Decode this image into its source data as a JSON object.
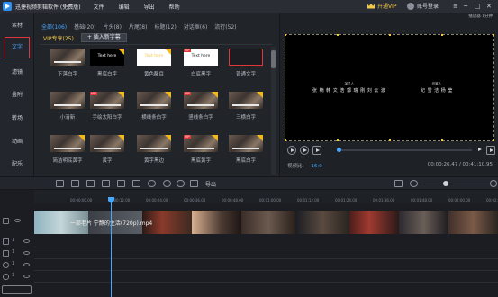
{
  "app": {
    "title": "迅捷视频剪辑软件 (免费版)",
    "menu": [
      "文件",
      "编辑",
      "导出",
      "帮助"
    ],
    "vip_label": "开通VIP",
    "login_label": "账号登录",
    "window_controls": [
      "≡",
      "─",
      "□",
      "✕"
    ],
    "accent": "#48a7ff",
    "highlight": "#e0353b"
  },
  "sidebar": {
    "items": [
      {
        "label": "素材"
      },
      {
        "label": "文字"
      },
      {
        "label": "滤镜"
      },
      {
        "label": "叠附"
      },
      {
        "label": "转场"
      },
      {
        "label": "动画"
      },
      {
        "label": "配乐"
      }
    ],
    "active_index": 1
  },
  "library": {
    "tabs": [
      "全部(106)",
      "基础(20)",
      "片头(8)",
      "片尾(8)",
      "标题(12)",
      "对话框(6)",
      "流行(52)"
    ],
    "active_tab": 0,
    "vip_tag": "VIP专享(25)",
    "add_button": "+ 插入新字幕",
    "items": [
      {
        "label": "下落白字",
        "style": "photo",
        "corner": false
      },
      {
        "label": "黑底白字",
        "style": "black",
        "text": "Text here",
        "corner": true,
        "vip": false
      },
      {
        "label": "黄色醒目",
        "style": "white",
        "text": "Text here",
        "corner": true
      },
      {
        "label": "白底黑字",
        "style": "gray",
        "text": "Text here",
        "corner": false,
        "vip": true
      },
      {
        "label": "普通文字",
        "style": "red",
        "corner": false
      },
      {
        "label": "小清新",
        "style": "photo",
        "corner": false
      },
      {
        "label": "手绘太阳白字",
        "style": "photo",
        "corner": true,
        "vip": true
      },
      {
        "label": "横线条白字",
        "style": "photo",
        "corner": true
      },
      {
        "label": "竖线条白字",
        "style": "photo",
        "corner": true,
        "vip": true
      },
      {
        "label": "三横白字",
        "style": "photo",
        "corner": true
      },
      {
        "label": "简洁明底黄字",
        "style": "photo",
        "corner": true
      },
      {
        "label": "黄字",
        "style": "photo",
        "corner": true
      },
      {
        "label": "黄字黑边",
        "style": "photo",
        "corner": true
      },
      {
        "label": "黑底黄字",
        "style": "photo",
        "corner": true,
        "vip": true
      },
      {
        "label": "黑底白字",
        "style": "photo",
        "corner": true
      }
    ]
  },
  "preview": {
    "header": "播放器 1分钟",
    "credits": [
      {
        "role": "演员人",
        "names": "张 楠  韩 文 浩  郭 瑞 刚  刘 云 波"
      },
      {
        "role": "统筹人",
        "names": "纪 雪 洁  杨 莹"
      }
    ],
    "ratio_label": "视频比:",
    "ratio_value": "16:9",
    "timecode": "00:00:26.47 / 00:41:10.95",
    "seek_fraction": 0.0
  },
  "toolbar": {
    "export_label": "导出"
  },
  "timeline": {
    "ruler_ticks": [
      "00:00:00.00",
      "00:00:12.00",
      "00:00:24.00",
      "00:00:36.00",
      "00:00:48.00",
      "00:01:00.00",
      "00:01:12.00",
      "00:01:24.00",
      "00:01:36.00",
      "00:01:48.00",
      "00:02:00.00",
      "00:02:12.00"
    ],
    "clip_label": "一部老片 宁静的生活(720p).mp4",
    "track_numbers": [
      "1",
      "1",
      "1",
      "1"
    ]
  }
}
